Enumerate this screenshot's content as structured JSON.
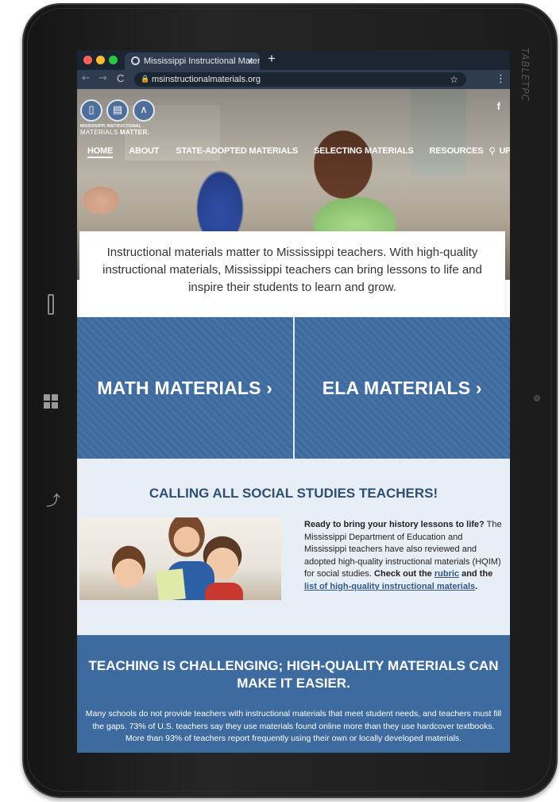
{
  "tablet": {
    "brand": "TABLETPC"
  },
  "browser": {
    "tab_title": "Mississippi Instructional Materi",
    "tab_close": "×",
    "new_tab": "+",
    "url": "msinstructionalmaterials.org",
    "back": "←",
    "forward": "→",
    "reload": "C",
    "star": "☆",
    "menu": "⋮"
  },
  "site": {
    "logo": {
      "line1": "MISSISSIPPI INSTRUCTIONAL",
      "line2_a": "MATERIALS ",
      "line2_b": "MATTER."
    },
    "facebook": "f",
    "nav": [
      {
        "label": "HOME",
        "active": true
      },
      {
        "label": "ABOUT"
      },
      {
        "label": "STATE-ADOPTED MATERIALS"
      },
      {
        "label": "SELECTING MATERIALS"
      },
      {
        "label": "RESOURCES"
      },
      {
        "label": "UPDATES"
      }
    ],
    "search_icon": "⚲",
    "intro": "Instructional materials matter to Mississippi teachers. With high-quality instructional materials, Mississippi teachers can bring lessons to life and inspire their students to learn and grow.",
    "tiles": {
      "math": "MATH MATERIALS ›",
      "ela": "ELA MATERIALS ›"
    },
    "social": {
      "title": "CALLING ALL SOCIAL STUDIES TEACHERS!",
      "lead": "Ready to bring your history lessons to life?",
      "body": " The Mississippi Department of Education and Mississippi teachers have also reviewed and adopted high-quality instructional materials (HQIM) for social studies. ",
      "cta": "Check out the ",
      "rubric_link": "rubric",
      "and_the": " and the ",
      "list_link": "list of high-quality instructional materials",
      "period": "."
    },
    "challenge": {
      "title": "TEACHING IS CHALLENGING; HIGH-QUALITY MATERIALS CAN MAKE IT EASIER.",
      "body": "Many schools do not provide teachers with instructional materials that meet student needs, and teachers must fill the gaps. 73% of U.S. teachers say they use materials found online more than they use hardcover textbooks. More than 93% of teachers report frequently using their own or locally developed materials."
    }
  }
}
